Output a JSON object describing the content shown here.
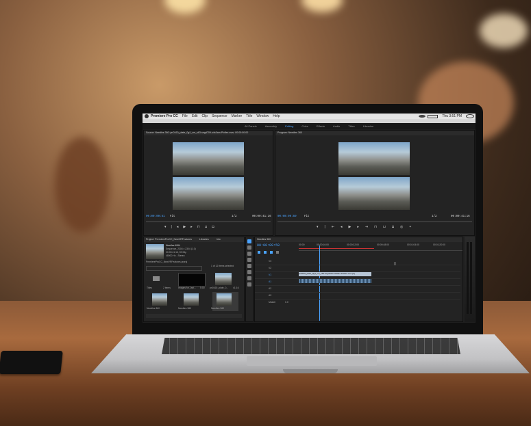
{
  "menubar": {
    "app": "Premiere Pro CC",
    "items": [
      "File",
      "Edit",
      "Clip",
      "Sequence",
      "Marker",
      "Title",
      "Window",
      "Help"
    ],
    "clock": "Thu 3:51 PM"
  },
  "workspaces": {
    "tabs": [
      "All Panels",
      "Assembly",
      "Editing",
      "Color",
      "Effects",
      "Audio",
      "Titles",
      "Libraries"
    ],
    "active": "Editing"
  },
  "source": {
    "title": "Source: Needles 360: pn0160_plate_0g1_cm_s63-segd709-s4s0am-Pixflex.mov: 00:00:00:00",
    "timecode_left": "00:00:09:51",
    "fit": "Fit",
    "ratio": "1/2",
    "timecode_right": "00:00:41:16"
  },
  "program": {
    "title": "Program: Needles 360",
    "timecode_left": "00:00:09:59",
    "fit": "Fit",
    "ratio": "1/2",
    "timecode_right": "00:00:41:16"
  },
  "project": {
    "title": "Project: PremiereProCC_NewVRFeatures",
    "tab2": "Libraries",
    "tab3": "Info",
    "seq_name": "Needles 4064",
    "seq_info1": "Sequence, 2304 x 2304 (1.0)",
    "seq_info2": "00:00:41:16, 59.94p",
    "seq_info3": "48000 Hz - Stereo",
    "project_file": "PremiereProCC_NewVRFeatures.prproj",
    "selected": "1 of 12 items selected",
    "items": [
      "Titles",
      "Needles 360",
      "Needles 360",
      "Needles 360"
    ],
    "items_row1": [
      "Titles",
      "Images for_last...",
      "pn0160_plate_0..."
    ],
    "items_meta": [
      "2 items",
      "5:00",
      "41:16"
    ]
  },
  "timeline": {
    "title": "Needles 360",
    "timecode": "00:00:09:59",
    "ruler": [
      "00:00",
      "00:00:16:00",
      "00:00:32:00",
      "00:00:48:00",
      "00:01:04:00",
      "00:01:20:00"
    ],
    "tracks": [
      "V3",
      "V2",
      "V1",
      "A1",
      "A2",
      "A3",
      "Master"
    ],
    "video_clip": "pn0160_plate_0g1_cm_s63-segd709-s4s0am-Pixflex.mov [V]",
    "audio_clip": "",
    "master_value": "0.0"
  },
  "colors": {
    "accent": "#4aa3ff",
    "playhead": "#4aa3ff",
    "video_clip": "#b8c6d6",
    "audio_clip": "#6b8fb3"
  }
}
